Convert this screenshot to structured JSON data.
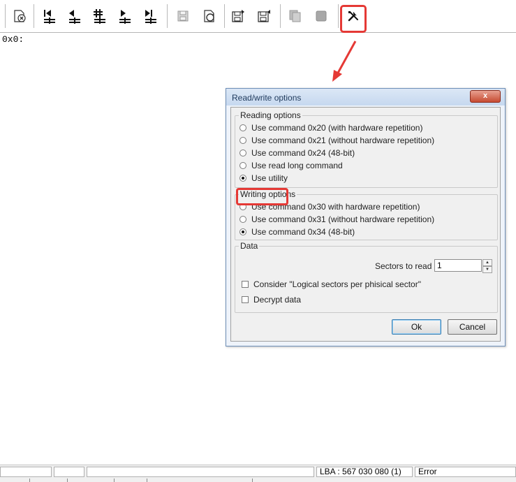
{
  "toolbar": {
    "buttons": [
      {
        "icon": "close-device-icon"
      },
      {
        "icon": "first-sector-icon"
      },
      {
        "icon": "previous-sector-icon"
      },
      {
        "icon": "goto-sector-icon"
      },
      {
        "icon": "next-sector-icon"
      },
      {
        "icon": "last-sector-icon"
      },
      {
        "icon": "save-icon"
      },
      {
        "icon": "refresh-icon"
      },
      {
        "icon": "save-sector-icon"
      },
      {
        "icon": "load-sector-icon"
      },
      {
        "icon": "copy-icon"
      },
      {
        "icon": "stop-icon"
      },
      {
        "icon": "tools-icon"
      }
    ],
    "highlight_color": "#e53935"
  },
  "hex_view": {
    "offset_text": "0x0:"
  },
  "dialog": {
    "title": "Read/write options",
    "close_label": "x",
    "reading": {
      "label": "Reading options",
      "options": [
        {
          "label": "Use command 0x20 (with hardware repetition)",
          "selected": false
        },
        {
          "label": "Use command 0x21 (without hardware repetition)",
          "selected": false
        },
        {
          "label": "Use command 0x24 (48-bit)",
          "selected": false
        },
        {
          "label": "Use read long command",
          "selected": false
        },
        {
          "label": "Use utility",
          "selected": true
        }
      ]
    },
    "writing": {
      "label": "Writing options",
      "options": [
        {
          "label": "Use command 0x30 with hardware repetition)",
          "selected": false
        },
        {
          "label": "Use command 0x31 (without hardware repetition)",
          "selected": false
        },
        {
          "label": "Use command 0x34 (48-bit)",
          "selected": true
        }
      ]
    },
    "data": {
      "label": "Data",
      "sectors_label": "Sectors to read",
      "sectors_value": "1",
      "checkboxes": [
        {
          "label": "Consider \"Logical sectors per phisical sector\"",
          "checked": false
        },
        {
          "label": "Decrypt data",
          "checked": false
        }
      ]
    },
    "ok_label": "Ok",
    "cancel_label": "Cancel"
  },
  "statusbar": {
    "lba": "LBA : 567 030 080 (1)",
    "status": "Error"
  }
}
